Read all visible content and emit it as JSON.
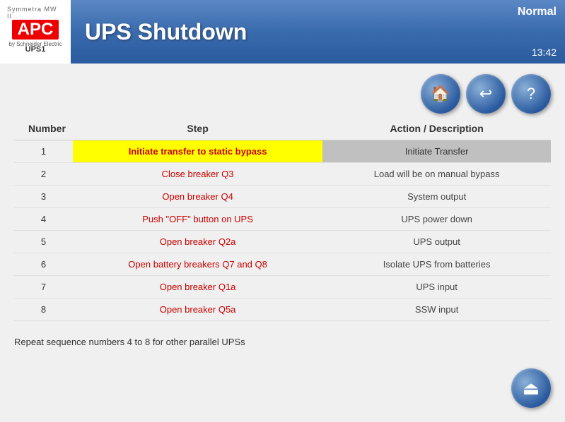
{
  "header": {
    "logo_top": "Symmetra MW II",
    "logo_main": "APC",
    "logo_bottom": "by Schneider Electric",
    "ups_id": "UPS1",
    "page_title": "UPS Shutdown",
    "status": "Normal",
    "time": "13:42"
  },
  "nav": {
    "home_icon": "🏠",
    "back_icon": "↩",
    "help_icon": "?"
  },
  "table": {
    "columns": [
      "Number",
      "Step",
      "Action / Description"
    ],
    "rows": [
      {
        "num": "1",
        "step": "Initiate transfer to static bypass",
        "action": "Initiate Transfer",
        "highlight": true
      },
      {
        "num": "2",
        "step": "Close breaker Q3",
        "action": "Load will be on manual bypass",
        "highlight": false
      },
      {
        "num": "3",
        "step": "Open breaker Q4",
        "action": "System output",
        "highlight": false
      },
      {
        "num": "4",
        "step": "Push \"OFF\" button on UPS",
        "action": "UPS power down",
        "highlight": false
      },
      {
        "num": "5",
        "step": "Open breaker Q2a",
        "action": "UPS output",
        "highlight": false
      },
      {
        "num": "6",
        "step": "Open battery breakers Q7 and Q8",
        "action": "Isolate UPS from batteries",
        "highlight": false
      },
      {
        "num": "7",
        "step": "Open breaker Q1a",
        "action": "UPS input",
        "highlight": false
      },
      {
        "num": "8",
        "step": "Open breaker Q5a",
        "action": "SSW input",
        "highlight": false
      }
    ]
  },
  "footer": {
    "note": "Repeat sequence numbers 4 to 8 for other parallel UPSs"
  },
  "bottom_icon": "⏻"
}
